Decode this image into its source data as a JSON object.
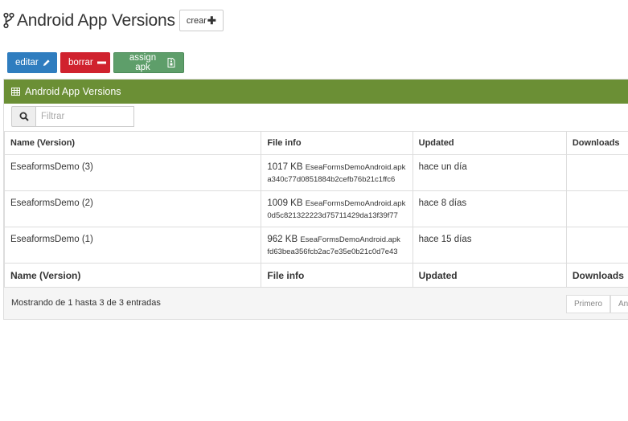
{
  "header": {
    "title": "Android App Versions",
    "create_label": "crear"
  },
  "actions": {
    "edit_label": "editar",
    "delete_label": "borrar",
    "assign_label": "assign apk"
  },
  "panel": {
    "title": "Android App Versions",
    "filter_placeholder": "Filtrar"
  },
  "table": {
    "columns": [
      "Name (Version)",
      "File info",
      "Updated",
      "Downloads"
    ],
    "rows": [
      {
        "name": "EseaformsDemo (3)",
        "size": "1017 KB",
        "file": "EseaFormsDemoAndroid.apk",
        "hash": "a340c77d0851884b2cefb76b21c1ffc6",
        "updated": "hace un día",
        "downloads": ""
      },
      {
        "name": "EseaformsDemo (2)",
        "size": "1009 KB",
        "file": "EseaFormsDemoAndroid.apk",
        "hash": "0d5c821322223d75711429da13f39f77",
        "updated": "hace 8 días",
        "downloads": ""
      },
      {
        "name": "EseaformsDemo (1)",
        "size": "962 KB",
        "file": "EseaFormsDemoAndroid.apk",
        "hash": "fd63bea356fcb2ac7e35e0b21c0d7e43",
        "updated": "hace 15 días",
        "downloads": ""
      }
    ]
  },
  "footer": {
    "info": "Mostrando de 1 hasta 3 de 3 entradas",
    "first_label": "Primero",
    "prev_label": "Ant"
  },
  "colors": {
    "panel_header": "#6b8f35",
    "edit": "#2f7dbf",
    "delete": "#d0222e",
    "assign": "#5e9e6a"
  }
}
